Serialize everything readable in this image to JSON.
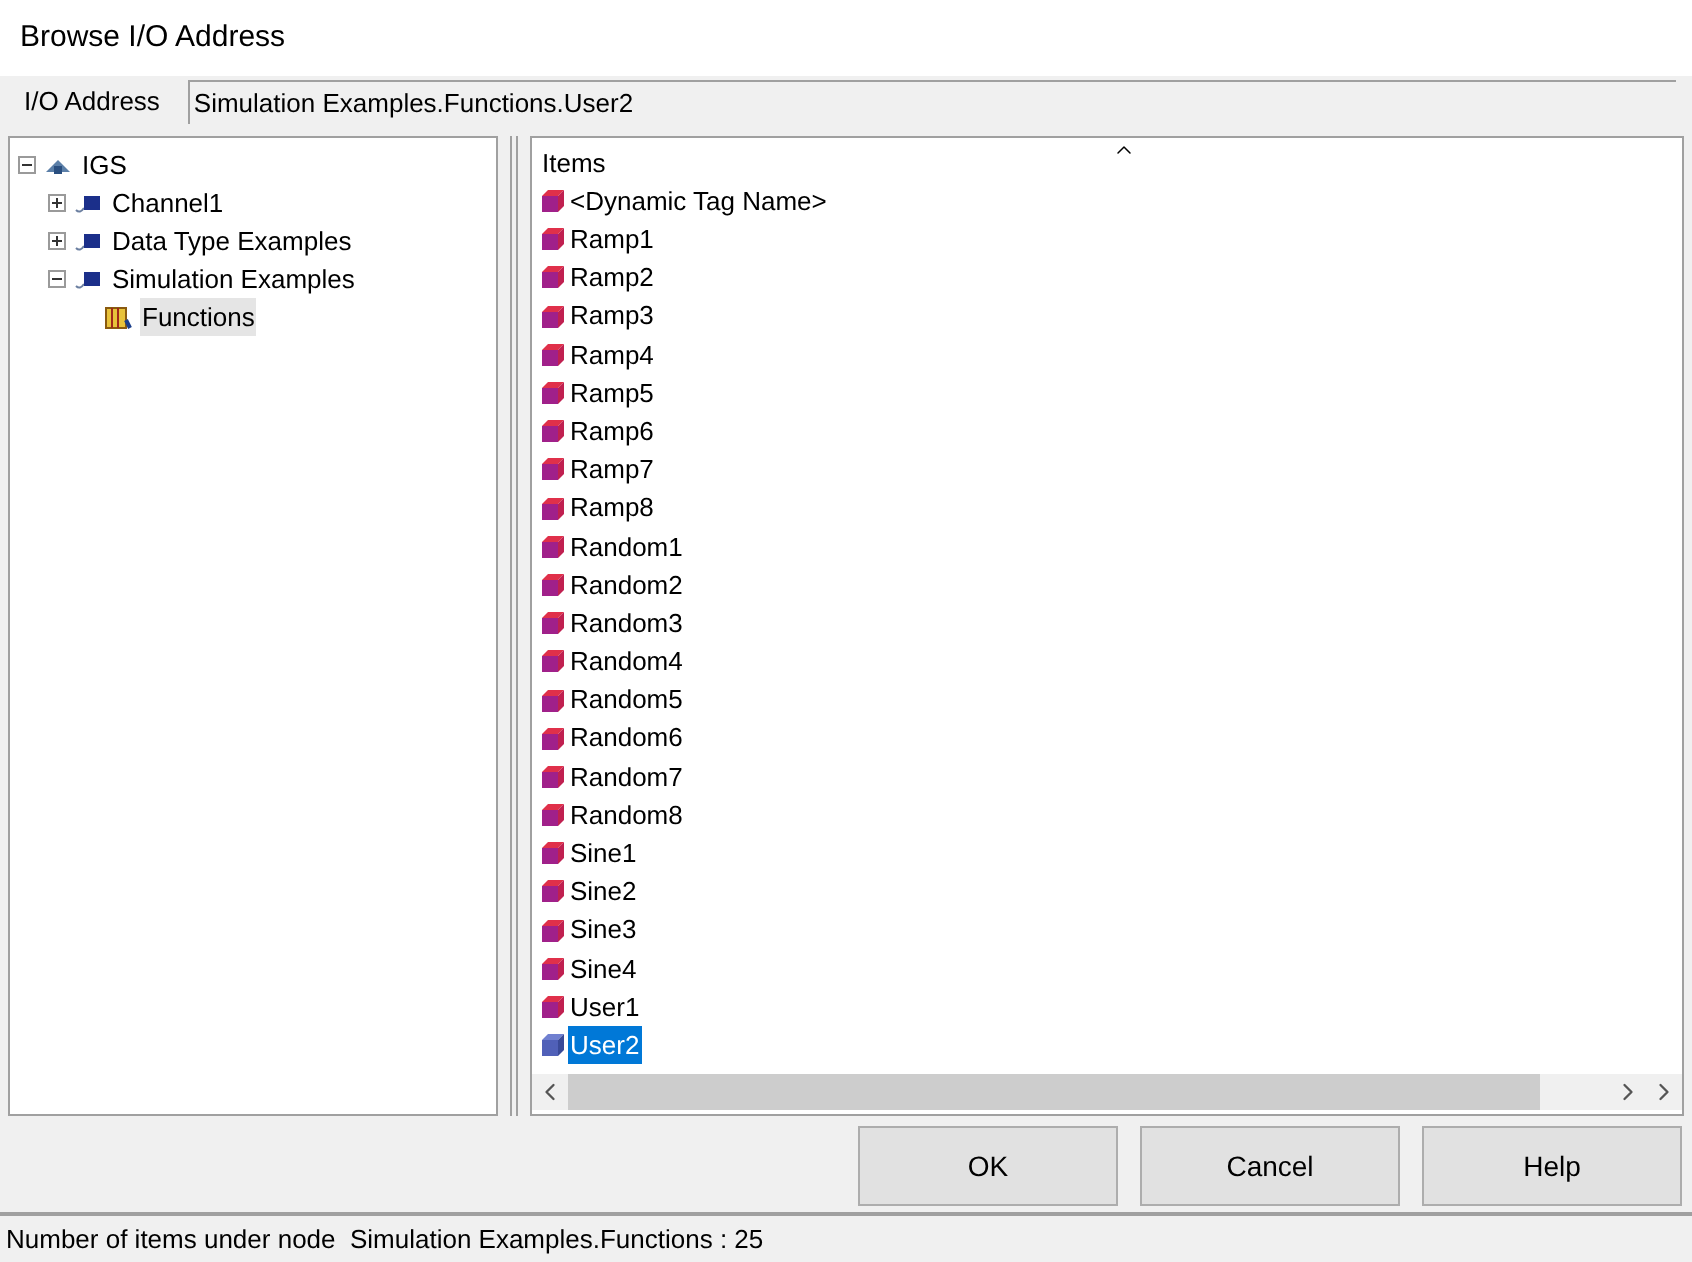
{
  "window": {
    "title": "Browse I/O Address"
  },
  "address": {
    "label": "I/O Address",
    "value": "Simulation Examples.Functions.User2"
  },
  "tree": [
    {
      "label": "IGS",
      "kind": "server",
      "expanded": true,
      "selected": false,
      "children": [
        {
          "label": "Channel1",
          "kind": "channel",
          "expanded": false,
          "selected": false
        },
        {
          "label": "Data Type Examples",
          "kind": "channel",
          "expanded": false,
          "selected": false
        },
        {
          "label": "Simulation Examples",
          "kind": "channel",
          "expanded": true,
          "selected": false,
          "children": [
            {
              "label": "Functions",
              "kind": "group",
              "selected": true
            }
          ]
        }
      ]
    }
  ],
  "items": {
    "header": "Items",
    "rows": [
      {
        "label": "<Dynamic Tag Name>",
        "selected": false
      },
      {
        "label": "Ramp1",
        "selected": false
      },
      {
        "label": "Ramp2",
        "selected": false
      },
      {
        "label": "Ramp3",
        "selected": false
      },
      {
        "label": "Ramp4",
        "selected": false
      },
      {
        "label": "Ramp5",
        "selected": false
      },
      {
        "label": "Ramp6",
        "selected": false
      },
      {
        "label": "Ramp7",
        "selected": false
      },
      {
        "label": "Ramp8",
        "selected": false
      },
      {
        "label": "Random1",
        "selected": false
      },
      {
        "label": "Random2",
        "selected": false
      },
      {
        "label": "Random3",
        "selected": false
      },
      {
        "label": "Random4",
        "selected": false
      },
      {
        "label": "Random5",
        "selected": false
      },
      {
        "label": "Random6",
        "selected": false
      },
      {
        "label": "Random7",
        "selected": false
      },
      {
        "label": "Random8",
        "selected": false
      },
      {
        "label": "Sine1",
        "selected": false
      },
      {
        "label": "Sine2",
        "selected": false
      },
      {
        "label": "Sine3",
        "selected": false
      },
      {
        "label": "Sine4",
        "selected": false
      },
      {
        "label": "User1",
        "selected": false
      },
      {
        "label": "User2",
        "selected": true
      }
    ]
  },
  "buttons": [
    "OK",
    "Cancel",
    "Help"
  ],
  "status_bar": "Number of items under node  Simulation Examples.Functions : 25"
}
